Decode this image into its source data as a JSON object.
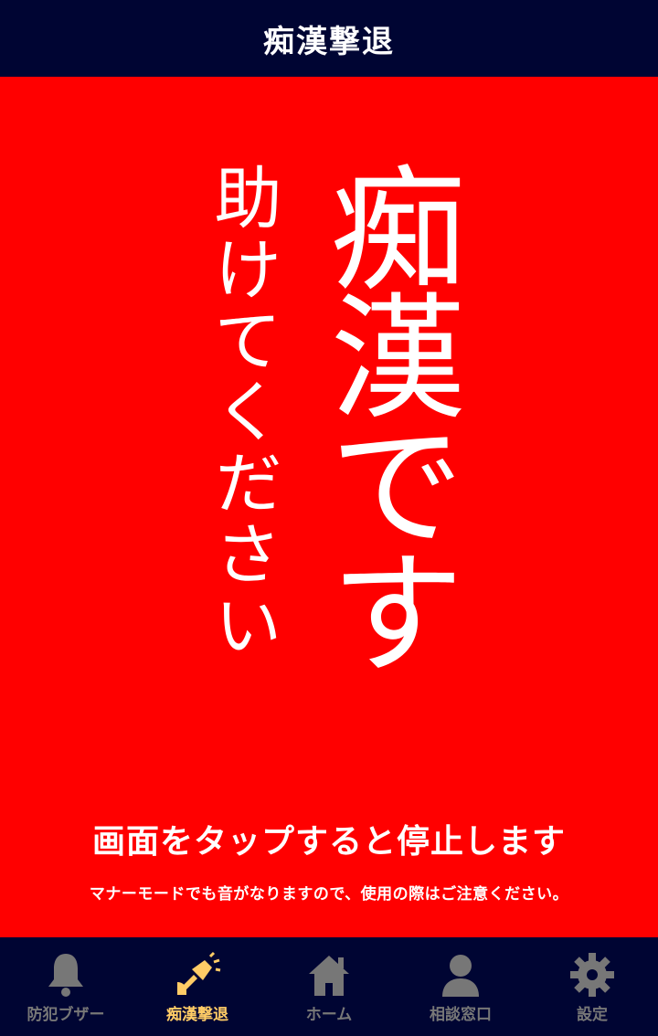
{
  "header": {
    "title": "痴漢撃退"
  },
  "main": {
    "vertical_main": "痴漢です",
    "vertical_sub": "助けてください",
    "stop_message": "画面をタップすると停止します",
    "notice": "マナーモードでも音がなりますので、使用の際はご注意ください。"
  },
  "tabs": [
    {
      "label": "防犯ブザー",
      "icon": "bell-icon",
      "active": false
    },
    {
      "label": "痴漢撃退",
      "icon": "megaphone-icon",
      "active": true
    },
    {
      "label": "ホーム",
      "icon": "home-icon",
      "active": false
    },
    {
      "label": "相談窓口",
      "icon": "person-icon",
      "active": false
    },
    {
      "label": "設定",
      "icon": "gear-icon",
      "active": false
    }
  ],
  "colors": {
    "background": "#ff0000",
    "bar": "#000533",
    "active_tab": "#ffcc66",
    "inactive_tab": "#777777",
    "text": "#ffffff"
  }
}
